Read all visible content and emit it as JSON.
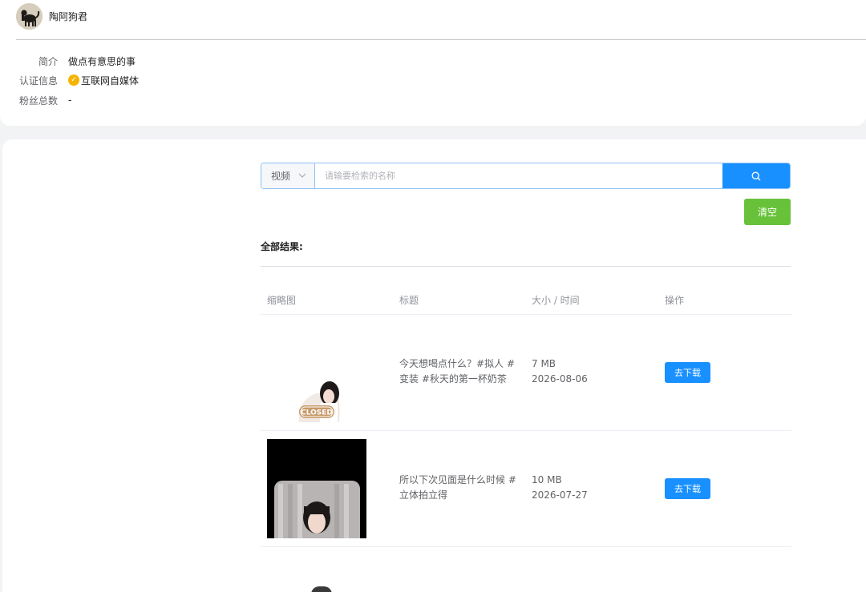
{
  "profile": {
    "name": "陶阿狗君",
    "rows": [
      {
        "label": "简介",
        "value": "做点有意思的事"
      },
      {
        "label": "认证信息",
        "value": "互联网自媒体"
      },
      {
        "label": "粉丝总数",
        "value": "-"
      }
    ]
  },
  "search": {
    "type": "视频",
    "placeholder": "请输要检索的名称",
    "clear_label": "清空"
  },
  "results": {
    "title": "全部结果:",
    "columns": [
      "缩略图",
      "标题",
      "大小 / 时间",
      "操作"
    ],
    "rows": [
      {
        "title": "今天想喝点什么？#拟人 #变装 #秋天的第一杯奶茶",
        "size": "7 MB",
        "date": "2026-08-06",
        "action": "去下载",
        "thumb_sign": "CLOSED"
      },
      {
        "title": "所以下次见面是什么时候 #立体拍立得",
        "size": "10 MB",
        "date": "2026-07-27",
        "action": "去下载"
      }
    ]
  },
  "colors": {
    "primary": "#1890ff",
    "success": "#67c23a",
    "badge": "#f5b400"
  },
  "icons": {
    "search": "search-icon",
    "dropdown": "chevron-down-icon",
    "verified": "verified-badge-icon"
  }
}
